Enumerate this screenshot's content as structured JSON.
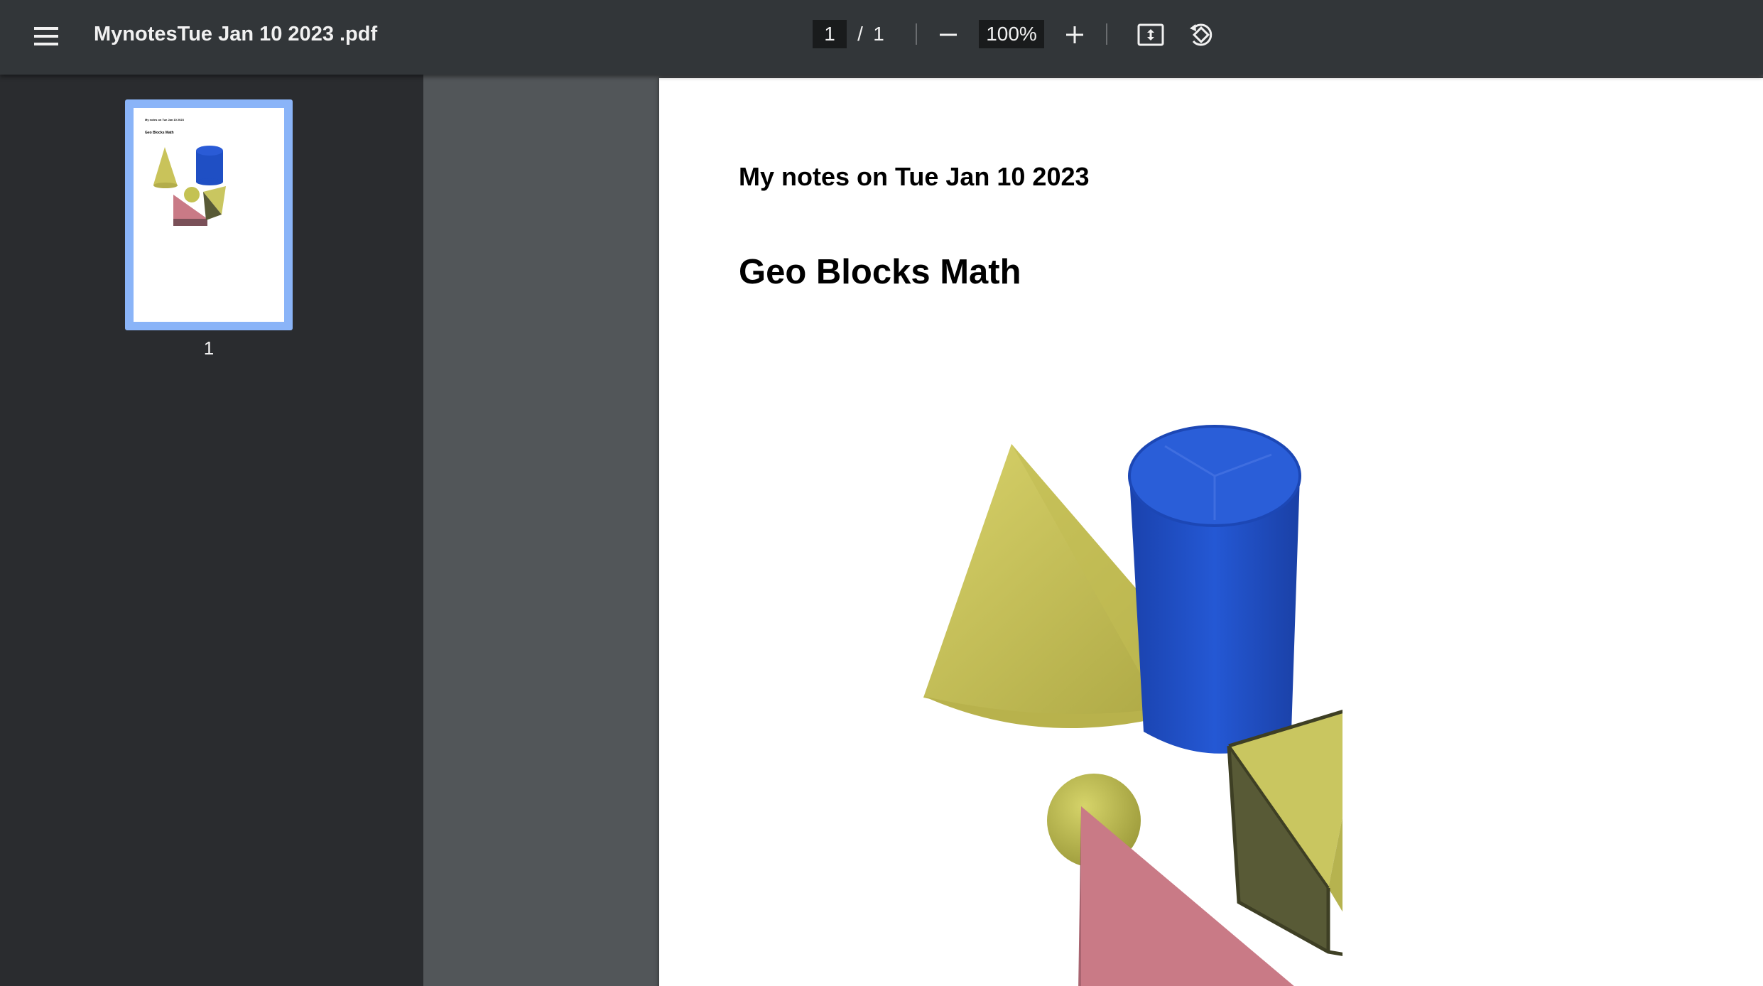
{
  "toolbar": {
    "menu_icon": "hamburger-menu-icon",
    "title": "MynotesTue Jan 10 2023 .pdf",
    "page_current": "1",
    "page_separator": "/",
    "page_total": "1",
    "zoom_out_icon": "minus-icon",
    "zoom_value": "100%",
    "zoom_in_icon": "plus-icon",
    "fit_icon": "fit-to-page-icon",
    "rotate_icon": "rotate-counterclockwise-icon"
  },
  "sidebar": {
    "thumbnails": [
      {
        "label": "1",
        "selected": true
      }
    ]
  },
  "document": {
    "heading1": "My notes on Tue Jan 10 2023",
    "heading2": "Geo Blocks Math",
    "image": "geometric-blocks-image"
  },
  "colors": {
    "toolbar_bg": "#323639",
    "sidebar_bg": "#2a2c2f",
    "viewer_bg": "#525659",
    "thumb_selected": "#8ab4f8",
    "cone": "#c9c35a",
    "cylinder": "#1f4fc4",
    "sphere": "#c4c253",
    "triangle_block": "#c97a86",
    "prism": "#c9c660"
  }
}
